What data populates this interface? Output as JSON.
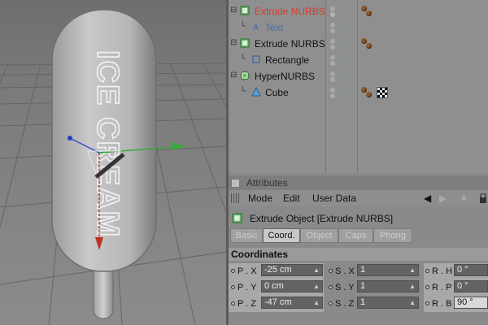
{
  "viewport": {
    "object_text_line1": "ICE",
    "object_text_line2": "CREAM"
  },
  "object_manager": {
    "rows": [
      {
        "name": "Extrude NURBS",
        "color": "#d83b2a",
        "icon": "extrude-nurbs-icon",
        "tags": [
          "material-tag"
        ]
      },
      {
        "name": "Text",
        "color": "#4a6fa5",
        "icon": "text-spline-icon",
        "tags": []
      },
      {
        "name": "Extrude NURBS",
        "color": "#111111",
        "icon": "extrude-nurbs-icon",
        "tags": [
          "material-tag"
        ]
      },
      {
        "name": "Rectangle",
        "color": "#111111",
        "icon": "rectangle-spline-icon",
        "tags": []
      },
      {
        "name": "HyperNURBS",
        "color": "#111111",
        "icon": "hypernurbs-icon",
        "tags": []
      },
      {
        "name": "Cube",
        "color": "#111111",
        "icon": "cube-icon",
        "tags": [
          "material-tag",
          "texture-tag"
        ]
      }
    ]
  },
  "attributes": {
    "header": "Attributes",
    "menu": [
      "Mode",
      "Edit",
      "User Data"
    ],
    "object_title": "Extrude Object [Extrude NURBS]",
    "tabs": [
      {
        "label": "Basic",
        "active": false
      },
      {
        "label": "Coord.",
        "active": true
      },
      {
        "label": "Object",
        "active": false
      },
      {
        "label": "Caps",
        "active": false
      },
      {
        "label": "Phong",
        "active": false
      }
    ],
    "section_title": "Coordinates",
    "params": {
      "px_label": "P . X",
      "px_value": "-25 cm",
      "py_label": "P . Y",
      "py_value": "0 cm",
      "pz_label": "P . Z",
      "pz_value": "-47 cm",
      "sx_label": "S . X",
      "sx_value": "1",
      "sy_label": "S . Y",
      "sy_value": "1",
      "sz_label": "S . Z",
      "sz_value": "1",
      "rh_label": "R . H",
      "rh_value": "0 °",
      "rp_label": "R . P",
      "rp_value": "0 °",
      "rb_label": "R . B",
      "rb_value": "90 °"
    }
  }
}
